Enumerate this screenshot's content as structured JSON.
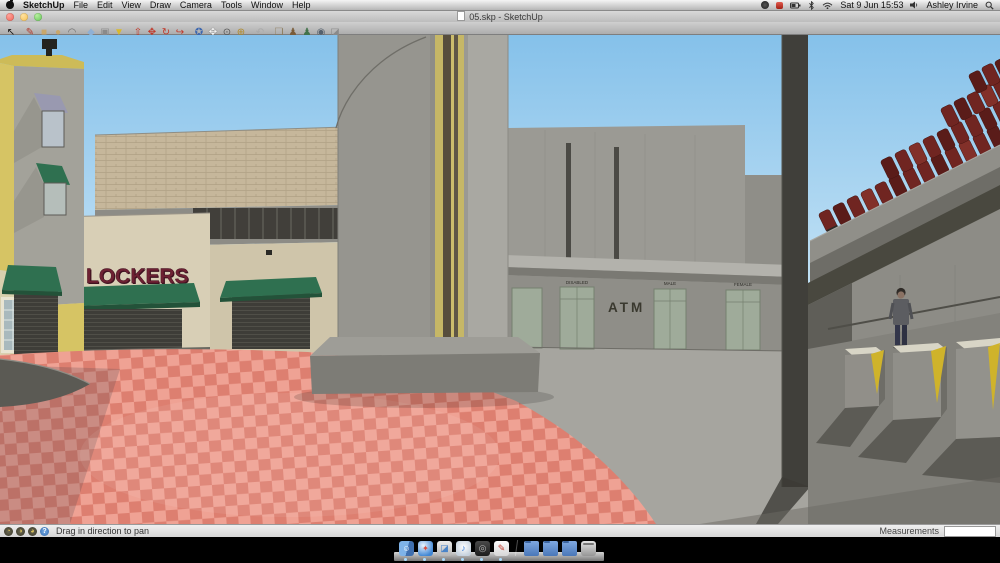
{
  "menu_bar": {
    "apple_menu": "apple-logo",
    "items": [
      "SketchUp",
      "File",
      "Edit",
      "View",
      "Draw",
      "Camera",
      "Tools",
      "Window",
      "Help"
    ],
    "status_icons": [
      "app-status",
      "screen-recording",
      "battery",
      "bluetooth",
      "wifi"
    ],
    "clock": "Sat 9 Jun 15:53",
    "user": "Ashley Irvine"
  },
  "window": {
    "title": "05.skp - SketchUp"
  },
  "toolbar": {
    "tools": [
      {
        "name": "select",
        "glyph": "↖",
        "style": "color:#141414"
      },
      {
        "name": "line",
        "glyph": "✎",
        "style": "color:#b03a2e"
      },
      {
        "name": "rectangle",
        "glyph": "■",
        "style": "color:#c9a76b"
      },
      {
        "name": "circle",
        "glyph": "●",
        "style": "color:#c9a76b"
      },
      {
        "name": "arc",
        "glyph": "◠",
        "style": "color:#6d6d6d"
      },
      {
        "name": "eraser",
        "glyph": "◆",
        "style": "color:#8fb0d4"
      },
      {
        "name": "tape-measure",
        "glyph": "▣",
        "style": "color:#8a8a8a"
      },
      {
        "name": "paint-bucket",
        "glyph": "▼",
        "style": "color:#d9b92c"
      },
      {
        "name": "push-pull",
        "glyph": "⇧",
        "style": "color:#c0392b"
      },
      {
        "name": "move",
        "glyph": "✥",
        "style": "color:#c0392b"
      },
      {
        "name": "rotate",
        "glyph": "↻",
        "style": "color:#c0392b"
      },
      {
        "name": "offset",
        "glyph": "↪",
        "style": "color:#c0392b"
      },
      {
        "name": "orbit",
        "glyph": "✪",
        "style": "color:#3a66b0"
      },
      {
        "name": "pan",
        "glyph": "✥",
        "style": "color:#f5f5f5;text-shadow:0 0 1px #444"
      },
      {
        "name": "zoom",
        "glyph": "⊙",
        "style": "color:#555555"
      },
      {
        "name": "zoom-extents",
        "glyph": "⊕",
        "style": "color:#b08a2a"
      },
      {
        "name": "previous",
        "glyph": "↶",
        "style": "color:#a9a9a9"
      },
      {
        "name": "make-component",
        "glyph": "❏",
        "style": "color:#8a7a5a"
      },
      {
        "name": "position-camera",
        "glyph": "♟",
        "style": "color:#7a5c38"
      },
      {
        "name": "walk",
        "glyph": "♟",
        "style": "color:#41724a"
      },
      {
        "name": "look-around",
        "glyph": "◉",
        "style": "color:#55616d"
      },
      {
        "name": "section-plane",
        "glyph": "◪",
        "style": "color:#8a8a8a"
      }
    ]
  },
  "viewport": {
    "signs": {
      "lockers": "LOCKERS",
      "atm": "ATM"
    },
    "door_labels": [
      "DISABLED",
      "MALE",
      "FEMALE"
    ],
    "colors": {
      "sky_top": "#85c1ea",
      "sky_bottom": "#d2eaf8",
      "tile_light": "#efa294",
      "tile_dark": "#dd7f70",
      "seat_red": "#702521",
      "seat_red_dark": "#5a1c19",
      "seat_red_light": "#823029",
      "awning_green": "#2f7050",
      "awning_green_dark": "#235239",
      "building_yellow": "#d6c464",
      "lockers_red": "#6e2133",
      "column_yellow": "#c6b766",
      "column_brown": "#574e3d",
      "glass_green": "#9fab9a",
      "window_awning_gray": "#9999b0"
    }
  },
  "status_bar": {
    "icons": [
      {
        "name": "hint-icon-1",
        "glyph": "◔"
      },
      {
        "name": "hint-icon-2",
        "glyph": "◑"
      },
      {
        "name": "hint-icon-3",
        "glyph": "◕"
      },
      {
        "name": "help-icon",
        "glyph": "?"
      }
    ],
    "hint": "Drag in direction to pan",
    "measurements_label": "Measurements",
    "measurements_value": ""
  },
  "dock": {
    "items": [
      {
        "name": "finder",
        "glyph": "☺"
      },
      {
        "name": "safari",
        "glyph": "✦"
      },
      {
        "name": "preview",
        "glyph": "◪"
      },
      {
        "name": "itunes",
        "glyph": "♪"
      },
      {
        "name": "media-app",
        "glyph": "◎"
      },
      {
        "name": "sketchup",
        "glyph": "✎"
      },
      {
        "name": "folder-1",
        "glyph": ""
      },
      {
        "name": "folder-2",
        "glyph": ""
      },
      {
        "name": "folder-3",
        "glyph": ""
      },
      {
        "name": "trash",
        "glyph": ""
      }
    ]
  }
}
